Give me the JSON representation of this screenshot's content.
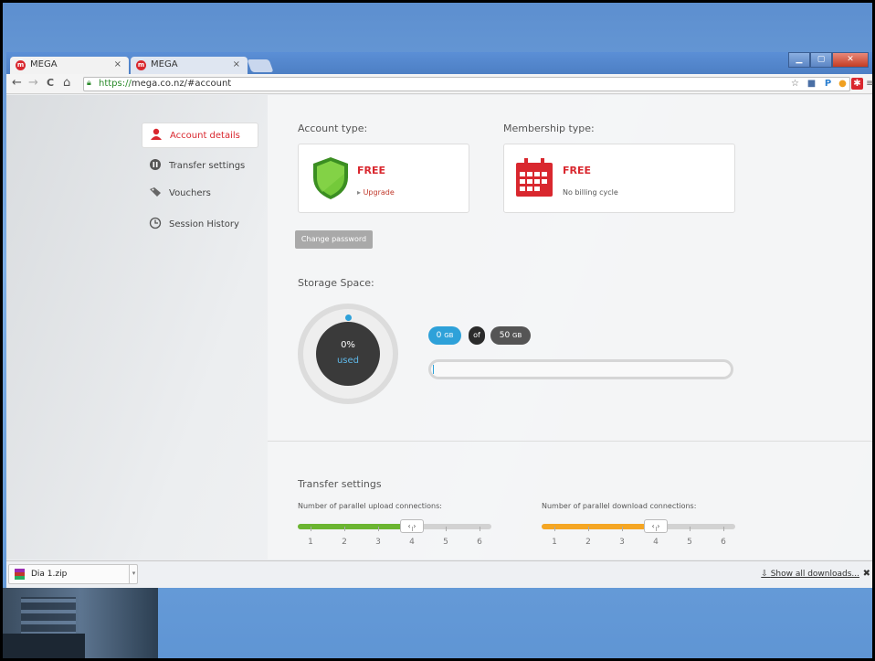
{
  "browser": {
    "tabs": [
      {
        "title": "MEGA",
        "close": "×"
      },
      {
        "title": "MEGA",
        "close": "×"
      }
    ],
    "window_controls": {
      "minimize": "▁",
      "maximize": "▢",
      "close": "✕"
    },
    "url": {
      "scheme": "https://",
      "rest": "mega.co.nz/#account"
    },
    "nav": {
      "back": "←",
      "forward": "→",
      "reload": "C",
      "home": "⌂"
    },
    "extensions": [
      "☆",
      "■",
      "P",
      "●",
      "✱",
      "≡"
    ]
  },
  "sidebar": {
    "items": [
      {
        "label": "Account details",
        "icon": "user-icon",
        "active": true
      },
      {
        "label": "Transfer settings",
        "icon": "transfer-icon"
      },
      {
        "label": "Vouchers",
        "icon": "tag-icon"
      },
      {
        "label": "Session History",
        "icon": "clock-icon"
      }
    ]
  },
  "account": {
    "account_type_label": "Account type:",
    "account_type_value": "FREE",
    "upgrade_link": "Upgrade",
    "membership_type_label": "Membership type:",
    "membership_value": "FREE",
    "billing_text": "No billing cycle",
    "change_password": "Change password"
  },
  "storage": {
    "label": "Storage Space:",
    "percent_text": "0%",
    "used_text": "used",
    "used_amount": "0",
    "used_unit": "GB",
    "of_text": "of",
    "total_amount": "50",
    "total_unit": "GB",
    "used_fraction": 0
  },
  "transfer": {
    "heading": "Transfer settings",
    "upload_label": "Number of parallel upload connections:",
    "download_label": "Number of parallel download connections:",
    "upload_value": 4,
    "download_value": 4,
    "ticks": [
      "1",
      "2",
      "3",
      "4",
      "5",
      "6"
    ],
    "handle_glyph": "‹ ›",
    "upload_color": "#6bb531",
    "download_color": "#f5a623"
  },
  "downloads": {
    "file_name": "Dia 1.zip",
    "show_all": "Show all downloads...",
    "close": "✖"
  },
  "colors": {
    "brand_red": "#d9272e",
    "accent_blue": "#2ea1d9"
  }
}
